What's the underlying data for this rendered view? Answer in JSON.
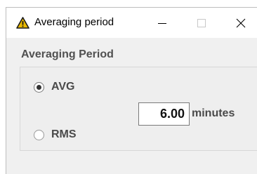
{
  "window": {
    "title": "Averaging period",
    "icon": "warning-triangle-icon",
    "buttons": {
      "minimize": "minimize-icon",
      "maximize": "maximize-icon",
      "close": "close-icon"
    }
  },
  "section": {
    "heading": "Averaging Period"
  },
  "options": {
    "avg_label": "AVG",
    "rms_label": "RMS",
    "selected": "AVG"
  },
  "value": {
    "amount": "6.00",
    "unit": "minutes"
  },
  "colors": {
    "icon_fill": "#e8b800",
    "icon_outline": "#1a1a1a"
  }
}
